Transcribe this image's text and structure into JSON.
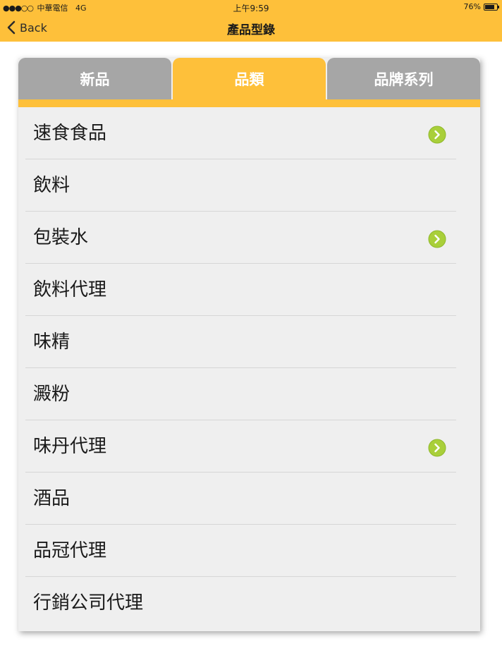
{
  "status_bar": {
    "signal": "●●●○○",
    "carrier": "中華電信",
    "network": "4G",
    "time": "上午9:59",
    "battery": "76%"
  },
  "nav": {
    "back_label": "Back",
    "title": "產品型錄"
  },
  "tabs": [
    {
      "label": "新品",
      "active": false
    },
    {
      "label": "品類",
      "active": true
    },
    {
      "label": "品牌系列",
      "active": false
    }
  ],
  "list": [
    {
      "label": "速食食品",
      "has_arrow": true
    },
    {
      "label": "飲料",
      "has_arrow": false
    },
    {
      "label": "包裝水",
      "has_arrow": true
    },
    {
      "label": "飲料代理",
      "has_arrow": false
    },
    {
      "label": "味精",
      "has_arrow": false
    },
    {
      "label": "澱粉",
      "has_arrow": false
    },
    {
      "label": "味丹代理",
      "has_arrow": true
    },
    {
      "label": "酒品",
      "has_arrow": false
    },
    {
      "label": "品冠代理",
      "has_arrow": false
    },
    {
      "label": "行銷公司代理",
      "has_arrow": false
    }
  ],
  "colors": {
    "accent": "#fec03a",
    "tab_inactive": "#a6a6a6",
    "list_bg": "#efefef",
    "arrow": "#a9cf3a"
  },
  "icons": {
    "back": "chevron-left-icon",
    "row_arrow": "chevron-right-circle-icon"
  }
}
